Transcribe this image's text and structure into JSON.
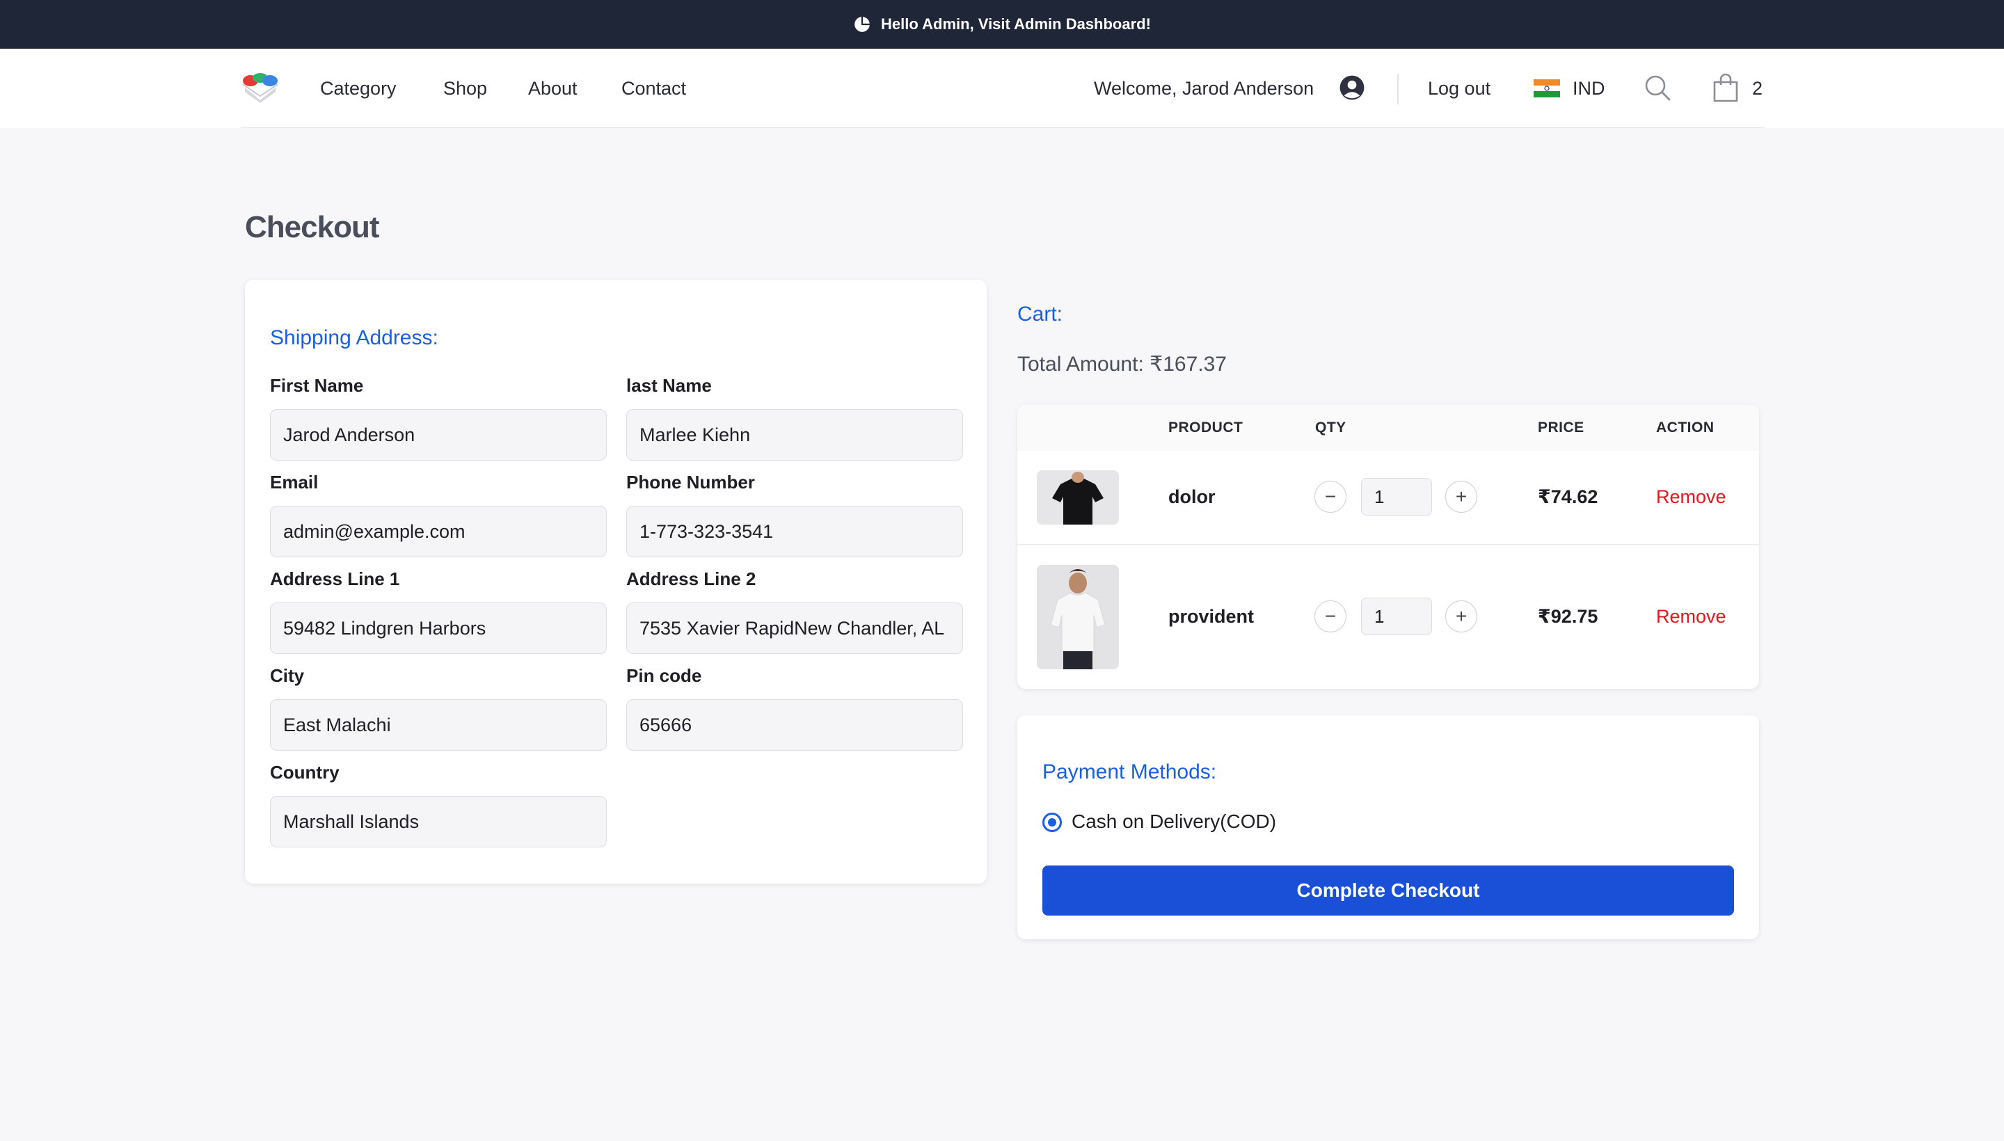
{
  "topbar": {
    "message": "Hello Admin, Visit Admin Dashboard!",
    "icon": "pie-chart-icon"
  },
  "nav": {
    "links": [
      "Category",
      "Shop",
      "About",
      "Contact"
    ],
    "welcome": "Welcome, Jarod Anderson",
    "logout": "Log out",
    "currency": "IND",
    "cart_count": "2"
  },
  "page_title": "Checkout",
  "shipping": {
    "title": "Shipping Address:",
    "fields": {
      "first_name": {
        "label": "First Name",
        "value": "Jarod Anderson"
      },
      "last_name": {
        "label": "last Name",
        "value": "Marlee Kiehn"
      },
      "email": {
        "label": "Email",
        "value": "admin@example.com"
      },
      "phone": {
        "label": "Phone Number",
        "value": "1-773-323-3541"
      },
      "address1": {
        "label": "Address Line 1",
        "value": "59482 Lindgren Harbors"
      },
      "address2": {
        "label": "Address Line 2",
        "value": "7535 Xavier RapidNew Chandler, AL"
      },
      "city": {
        "label": "City",
        "value": "East Malachi"
      },
      "pin": {
        "label": "Pin code",
        "value": "65666"
      },
      "country": {
        "label": "Country",
        "value": "Marshall Islands"
      }
    }
  },
  "cart": {
    "title": "Cart:",
    "total": "Total Amount: ₹167.37",
    "headers": {
      "product": "PRODUCT",
      "qty": "QTY",
      "price": "PRICE",
      "action": "ACTION"
    },
    "items": [
      {
        "name": "dolor",
        "qty": "1",
        "price": "₹74.62",
        "action": "Remove"
      },
      {
        "name": "provident",
        "qty": "1",
        "price": "₹92.75",
        "action": "Remove"
      }
    ]
  },
  "payment": {
    "title": "Payment Methods:",
    "option": "Cash on Delivery(COD)",
    "button": "Complete Checkout"
  },
  "colors": {
    "accent": "#1b5fe0",
    "button": "#1a4fd8",
    "danger": "#e0181f",
    "topbar": "#1f2637"
  }
}
